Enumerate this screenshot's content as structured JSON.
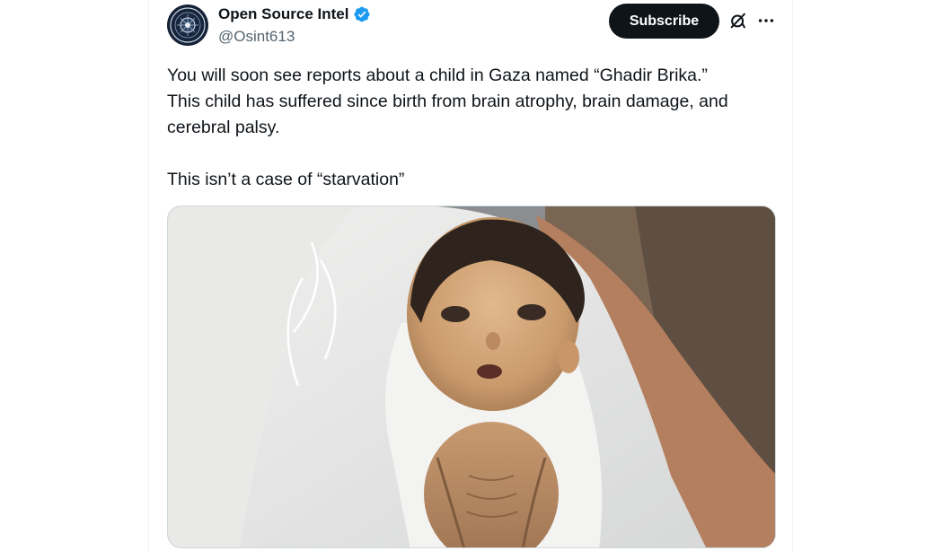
{
  "author": {
    "name": "Open Source Intel",
    "handle": "@Osint613",
    "verified": true,
    "avatar_icon": "osint-emblem-avatar"
  },
  "actions": {
    "subscribe_label": "Subscribe",
    "grok_icon": "grok-icon",
    "more_icon": "more-dots-icon"
  },
  "tweet": {
    "text": "You will soon see reports about a child in Gaza named “Ghadir Brika.”\nThis child has suffered since birth from brain atrophy, brain damage, and\ncerebral palsy.\n\nThis isn’t a case of “starvation”"
  },
  "media": {
    "type": "photo",
    "content": "emaciated infant wrapped in white cloth"
  },
  "colors": {
    "text": "#0f1419",
    "secondary": "#536471",
    "verified_badge": "#1d9bf0",
    "button_bg": "#0f1419"
  }
}
